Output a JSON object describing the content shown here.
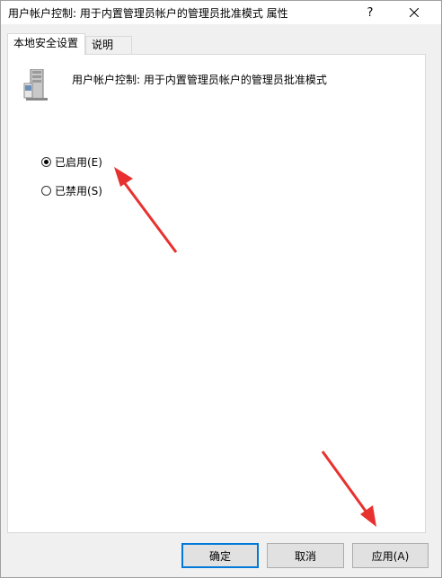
{
  "window": {
    "title": "用户帐户控制: 用于内置管理员帐户的管理员批准模式 属性",
    "help_label": "?"
  },
  "tabs": [
    {
      "label": "本地安全设置",
      "active": true
    },
    {
      "label": "说明",
      "active": false
    }
  ],
  "policy": {
    "name": "用户帐户控制: 用于内置管理员帐户的管理员批准模式",
    "icon": "server-icon"
  },
  "options": [
    {
      "label": "已启用(E)",
      "checked": true
    },
    {
      "label": "已禁用(S)",
      "checked": false
    }
  ],
  "buttons": {
    "ok": "确定",
    "cancel": "取消",
    "apply": "应用(A)"
  },
  "colors": {
    "annotation_arrow": "#e8312f",
    "focus_border": "#0078d7"
  }
}
